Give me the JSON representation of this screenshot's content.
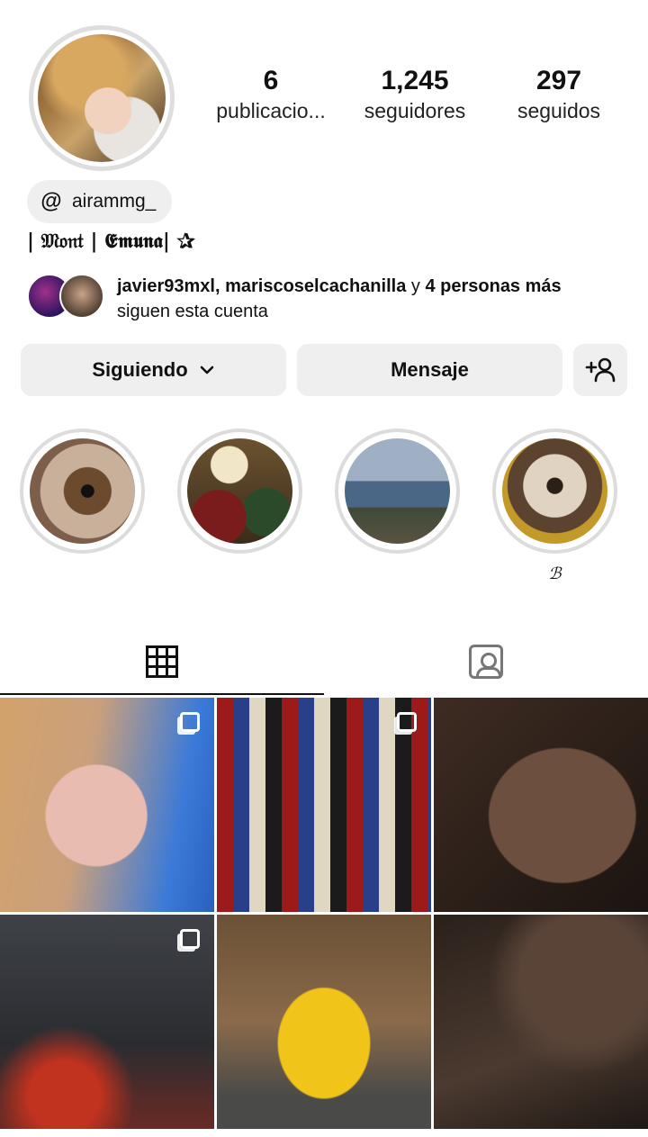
{
  "profile": {
    "avatar_description": "profile-photo",
    "stats": [
      {
        "value": "6",
        "label": "publicacio..."
      },
      {
        "value": "1,245",
        "label": "seguidores"
      },
      {
        "value": "297",
        "label": "seguidos"
      }
    ],
    "threads_handle": "airammg_",
    "bio": "| 𝔐𝔬𝔫𝔱 | 𝕰𝖒𝖚𝖓𝖆| ✰",
    "followed_by": {
      "names": "javier93mxl, mariscoselcachanilla",
      "connector": " y ",
      "others": "4 personas más",
      "suffix": "siguen esta cuenta"
    }
  },
  "buttons": {
    "following": "Siguiendo",
    "message": "Mensaje",
    "add_user_icon": "add-user-icon"
  },
  "highlights": [
    {
      "label": ""
    },
    {
      "label": ""
    },
    {
      "label": ""
    },
    {
      "label": "ℬ"
    }
  ],
  "tabs": {
    "grid_icon": "grid-icon",
    "tagged_icon": "tagged-icon"
  },
  "colors": {
    "button_bg": "#efefef",
    "text": "#111111",
    "ring": "#dedede"
  }
}
